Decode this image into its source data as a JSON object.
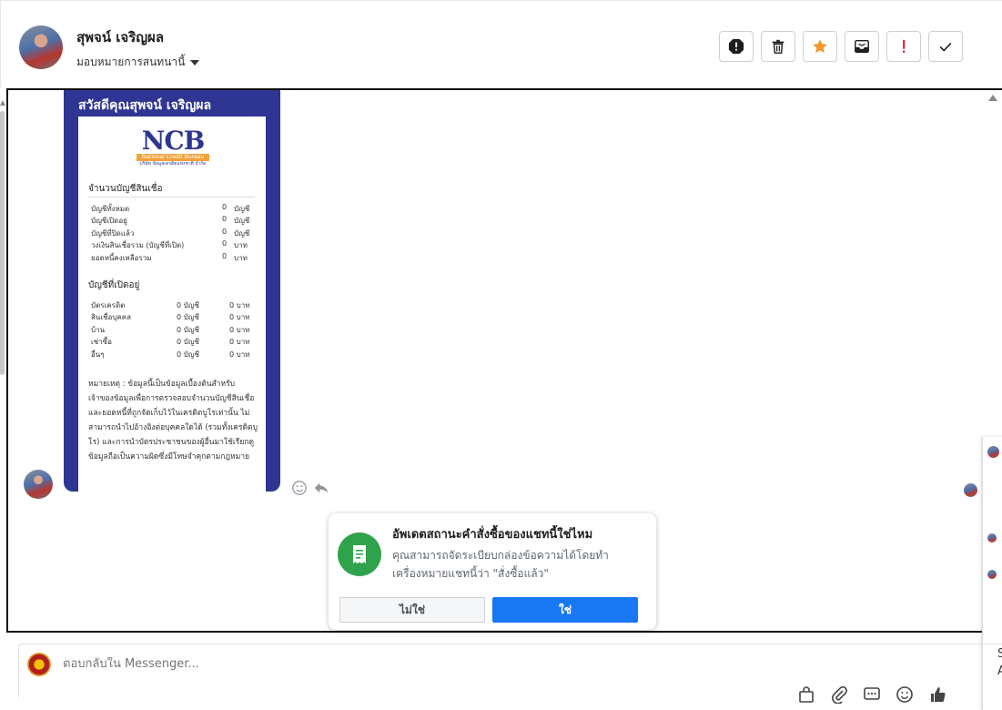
{
  "header": {
    "contact_name": "สุพจน์ เจริญผล",
    "assign_label": "มอบหมายการสนทนานี้",
    "tools": [
      "spam-icon",
      "trash-icon",
      "star-icon",
      "archive-icon",
      "important-icon",
      "check-icon"
    ]
  },
  "card": {
    "greeting": "สวัสดีคุณสุพจน์ เจริญผล",
    "logo": {
      "text": "NCB",
      "bar": "National Credit Bureau",
      "sub": "บริษัท ข้อมูลเครดิตแห่งชาติ จำกัด"
    },
    "section1_title": "จำนวนบัญชีสินเชื่อ",
    "section1_rows": [
      {
        "label": "บัญชีทั้งหมด",
        "value": "0",
        "unit": "บัญชี"
      },
      {
        "label": "บัญชีเปิดอยู่",
        "value": "0",
        "unit": "บัญชี"
      },
      {
        "label": "บัญชีที่ปิดแล้ว",
        "value": "0",
        "unit": "บัญชี"
      },
      {
        "label": "วงเงินสินเชื่อรวม (บัญชีที่เปิด)",
        "value": "0",
        "unit": "บาท"
      },
      {
        "label": "ยอดหนี้คงเหลือรวม",
        "value": "0",
        "unit": "บาท"
      }
    ],
    "section2_title": "บัญชีที่เปิดอยู่",
    "section2_rows": [
      {
        "label": "บัตรเครดิต",
        "count": "0 บัญชี",
        "amount": "0 บาท"
      },
      {
        "label": "สินเชื่อบุคคล",
        "count": "0 บัญชี",
        "amount": "0 บาท"
      },
      {
        "label": "บ้าน",
        "count": "0 บัญชี",
        "amount": "0 บาท"
      },
      {
        "label": "เช่าซื้อ",
        "count": "0 บัญชี",
        "amount": "0 บาท"
      },
      {
        "label": "อื่นๆ",
        "count": "0 บัญชี",
        "amount": "0 บาท"
      }
    ],
    "note": "หมายเหตุ : ข้อมูลนี้เป็นข้อมูลเบื้องต้นสำหรับเจ้าของข้อมูลเพื่อการตรวจสอบจำนวนบัญชีสินเชื่อและยอดหนี้ที่ถูกจัดเก็บไว้ในเครดิตบูโรเท่านั้น ไม่สามารถนำไปอ้างอิงต่อบุคคลใดได้ (รวมทั้งเครดิตบูโร) และการนำบัตรประชาชนของผู้อื่นมาใช้เรียกดูข้อมูลถือเป็นความผิดซึ่งมีโทษจำคุกตามกฎหมาย"
  },
  "popup": {
    "title": "อัพเดตสถานะคำสั่งซื้อของแชทนี้ใช่ไหม",
    "body": "คุณสามารถจัดระเบียบกล่องข้อความได้โดยทำเครื่องหมายแชทนี้ว่า \"สั่งซื้อแล้ว\"",
    "no_label": "ไม่ใช่",
    "yes_label": "ใช่"
  },
  "side_panel": {
    "texts": [
      "S",
      "A"
    ]
  },
  "composer": {
    "placeholder": "ตอบกลับใน Messenger...",
    "tools": [
      "bag-icon",
      "attach-icon",
      "saved-reply-icon",
      "emoji-icon",
      "like-icon"
    ]
  },
  "colors": {
    "brand_blue": "#1877f2",
    "ncb_navy": "#2e3593",
    "ncb_orange": "#f2a23a",
    "success_green": "#31a24c"
  }
}
